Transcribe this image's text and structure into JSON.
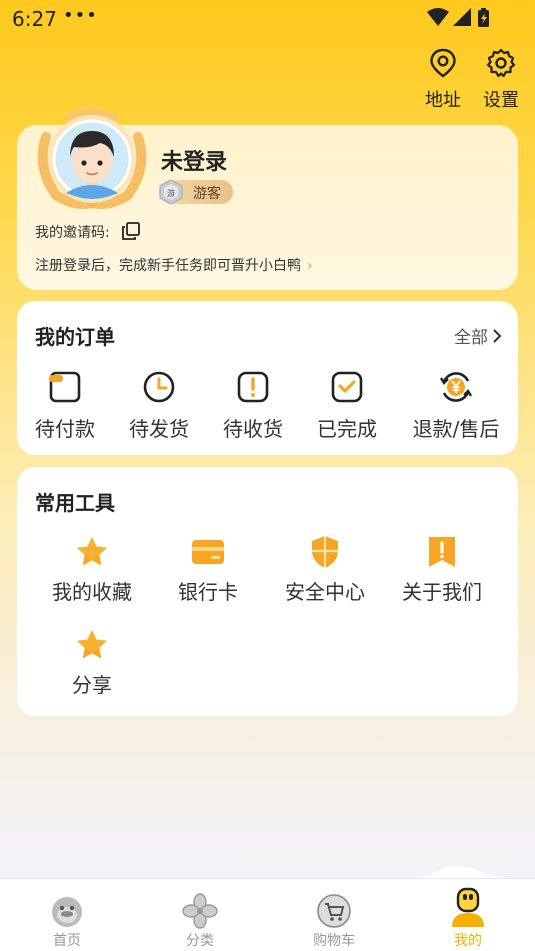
{
  "status_bar": {
    "time": "6:27",
    "dots": "•••"
  },
  "top_actions": {
    "address_label": "地址",
    "settings_label": "设置"
  },
  "profile": {
    "name": "未登录",
    "badge_label": "游客",
    "badge_coin_text": "游",
    "invite_label": "我的邀请码:",
    "hint": "注册登录后，完成新手任务即可晋升小白鸭",
    "hint_chevron": "›"
  },
  "orders": {
    "title": "我的订单",
    "all_label": "全部",
    "items": [
      {
        "label": "待付款",
        "icon": "wallet-icon"
      },
      {
        "label": "待发货",
        "icon": "clock-icon"
      },
      {
        "label": "待收货",
        "icon": "exclamation-box-icon"
      },
      {
        "label": "已完成",
        "icon": "check-box-icon"
      },
      {
        "label": "退款/售后",
        "icon": "yen-refund-icon"
      }
    ]
  },
  "tools": {
    "title": "常用工具",
    "items": [
      {
        "label": "我的收藏",
        "icon": "star-icon"
      },
      {
        "label": "银行卡",
        "icon": "bank-card-icon"
      },
      {
        "label": "安全中心",
        "icon": "shield-icon"
      },
      {
        "label": "关于我们",
        "icon": "bookmark-icon"
      },
      {
        "label": "分享",
        "icon": "star-icon"
      }
    ]
  },
  "tabbar": {
    "items": [
      {
        "label": "首页",
        "icon": "duck-home-icon",
        "active": false
      },
      {
        "label": "分类",
        "icon": "clover-icon",
        "active": false
      },
      {
        "label": "购物车",
        "icon": "cart-icon",
        "active": false
      },
      {
        "label": "我的",
        "icon": "user-icon",
        "active": true
      }
    ]
  },
  "colors": {
    "accent": "#FFC91E",
    "icon_orange": "#F6A623",
    "active_tab": "#F0B400"
  }
}
